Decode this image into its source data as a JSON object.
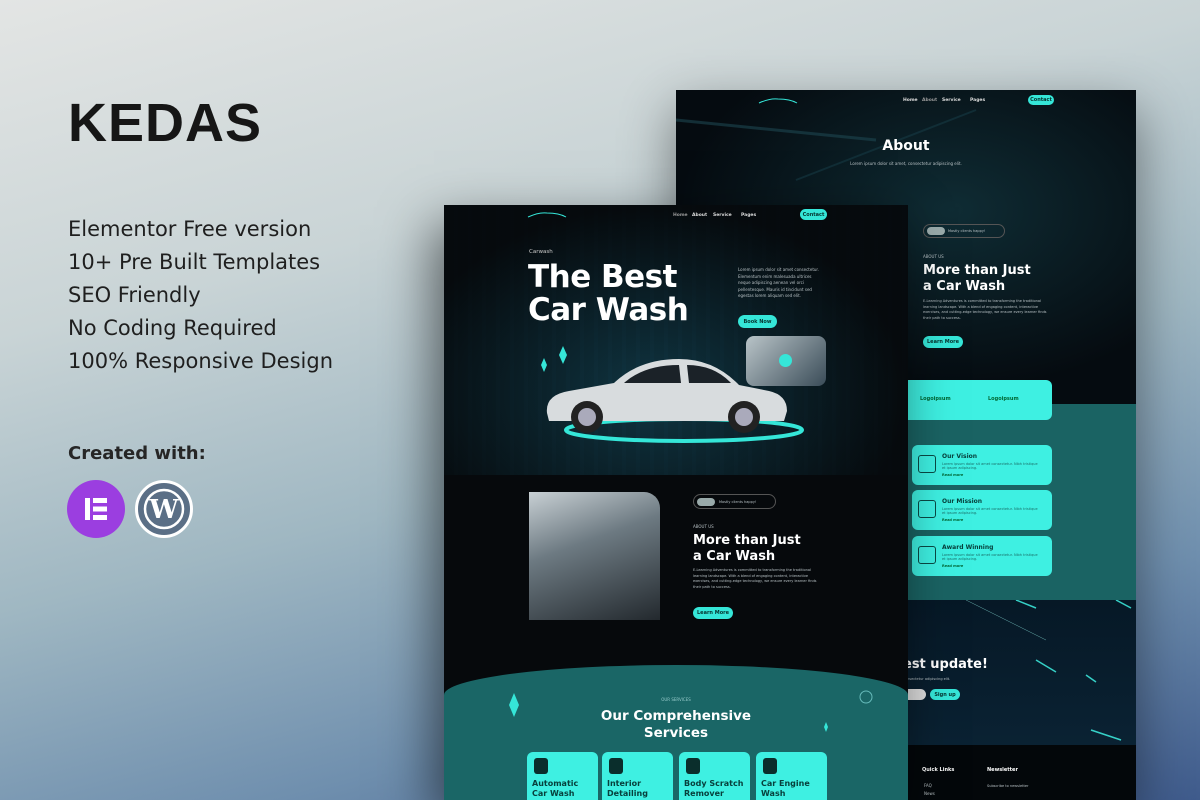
{
  "promo": {
    "brand": "KEDAS",
    "features": [
      "Elementor Free version",
      "10+ Pre Built Templates",
      "SEO Friendly",
      "No Coding Required",
      "100% Responsive Design"
    ],
    "created_with": "Created with:",
    "tools": [
      "elementor-icon",
      "wordpress-icon"
    ]
  },
  "colors": {
    "accent": "#35e6d8",
    "teal_section": "#1a6666",
    "dark": "#06090c",
    "elementor": "#92003b",
    "elementor_purple": "#9b3ee0"
  },
  "nav": {
    "home": "Home",
    "about": "About",
    "service": "Service",
    "pages": "Pages",
    "contact": "Contact"
  },
  "about_page": {
    "title": "About",
    "subtitle": "Lorem ipsum dolor sit amet, consectetur adipiscing elit.",
    "badge": "Mostly clients happy!",
    "eyebrow": "ABOUT US",
    "heading_1": "More than Just",
    "heading_2": "a Car Wash",
    "paragraph": "E-Learning Adventures is committed to transforming the traditional learning landscape. With a blend of engaging content, interactive exercises, and cutting-edge technology, we ensure every learner finds their path to success.",
    "learn_more": "Learn More",
    "logos": [
      "Logoipsum",
      "Logoipsum"
    ],
    "cards": [
      {
        "title": "Our Vision",
        "text": "Lorem ipsum dolor sit amet consectetur. Nibh tristique et ipsum adipiscing.",
        "link": "Read more"
      },
      {
        "title": "Our Mission",
        "text": "Lorem ipsum dolor sit amet consectetur. Nibh tristique et ipsum adipiscing.",
        "link": "Read more"
      },
      {
        "title": "Award Winning",
        "text": "Lorem ipsum dolor sit amet consectetur. Nibh tristique et ipsum adipiscing.",
        "link": "Read more"
      }
    ],
    "newsletter_heading": "est update!",
    "newsletter_sub": "consectetur adipiscing elit.",
    "sign_up": "Sign up",
    "footer": {
      "quick_links": "Quick Links",
      "newsletter": "Newsletter",
      "links": [
        "FAQ",
        "News"
      ],
      "newsletter_text": "Subscribe to newsletter"
    }
  },
  "home_page": {
    "eyebrow": "Carwash",
    "title_1": "The Best",
    "title_2": "Car Wash",
    "hero_text": "Lorem ipsum dolor sit amet consectetur. Elementum enim malesuada ultrices neque adipiscing aenean vel orci pellentesque. Mauris id tincidunt sed egestas lorem aliquam sed elit.",
    "book_now": "Book Now",
    "badge": "Mostly clients happy!",
    "eyebrow_about": "ABOUT US",
    "heading_1": "More than Just",
    "heading_2": "a Car Wash",
    "paragraph": "E-Learning Adventures is committed to transforming the traditional learning landscape. With a blend of engaging content, interactive exercises, and cutting-edge technology, we ensure every learner finds their path to success.",
    "learn_more": "Learn More",
    "services_eyebrow": "OUR SERVICES",
    "services_1": "Our Comprehensive",
    "services_2": "Services",
    "services": [
      {
        "l1": "Automatic",
        "l2": "Car Wash"
      },
      {
        "l1": "Interior",
        "l2": "Detailing"
      },
      {
        "l1": "Body Scratch",
        "l2": "Remover"
      },
      {
        "l1": "Car Engine",
        "l2": "Wash"
      }
    ]
  }
}
